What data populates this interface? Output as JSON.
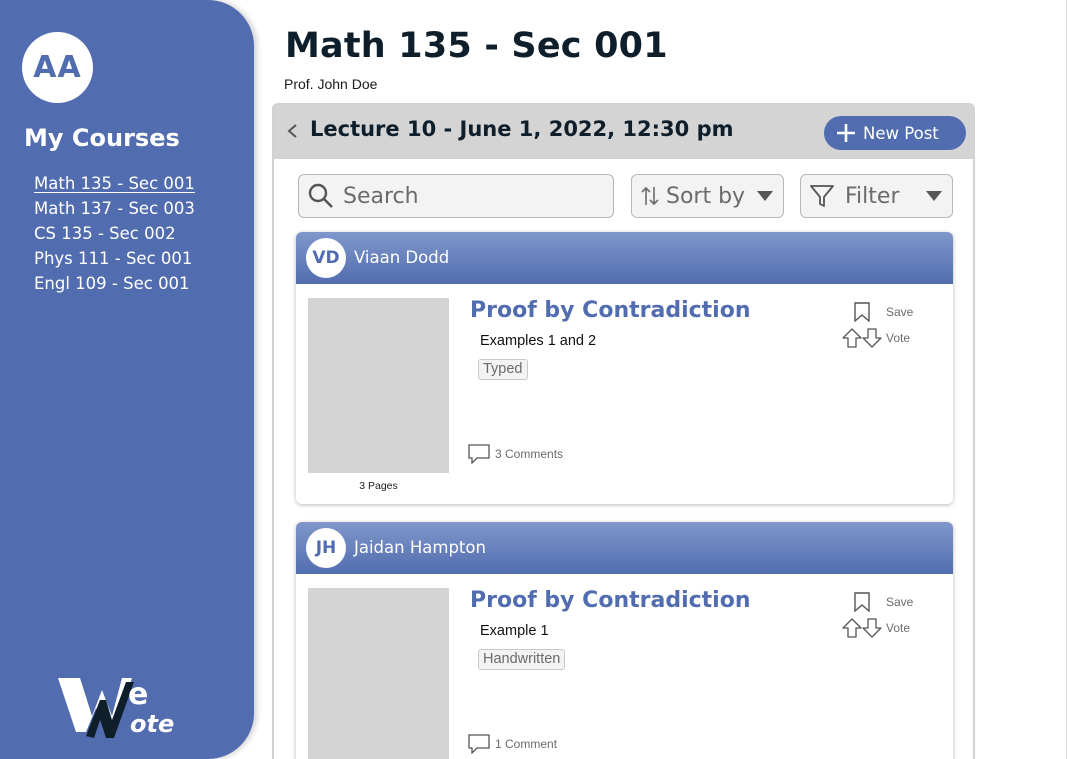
{
  "user": {
    "initials": "AA"
  },
  "sidebar": {
    "heading": "My Courses",
    "courses": [
      {
        "label": "Math 135 - Sec 001",
        "active": true
      },
      {
        "label": "Math 137 - Sec 003",
        "active": false
      },
      {
        "label": "CS 135 - Sec 002",
        "active": false
      },
      {
        "label": "Phys 111 - Sec 001",
        "active": false
      },
      {
        "label": "Engl 109 - Sec 001",
        "active": false
      }
    ],
    "logo_text": "WeNote"
  },
  "header": {
    "title": "Math 135 - Sec 001",
    "professor": "Prof. John Doe"
  },
  "lecture": {
    "title": "Lecture 10 - June 1, 2022, 12:30 pm",
    "new_post_label": "New Post"
  },
  "toolbar": {
    "search_placeholder": "Search",
    "sort_label": "Sort by",
    "filter_label": "Filter"
  },
  "posts": [
    {
      "initials": "VD",
      "author": "Viaan Dodd",
      "title": "Proof by Contradiction",
      "subtitle": "Examples 1 and 2",
      "tag": "Typed",
      "pages": "3 Pages",
      "comments": "3 Comments",
      "save_label": "Save",
      "vote_label": "Vote"
    },
    {
      "initials": "JH",
      "author": "Jaidan Hampton",
      "title": "Proof by Contradiction",
      "subtitle": "Example 1",
      "tag": "Handwritten",
      "pages": "",
      "comments": "1 Comment",
      "save_label": "Save",
      "vote_label": "Vote"
    }
  ],
  "colors": {
    "primary": "#526daf",
    "header_gradient_top": "#7f97cb",
    "title_text": "#0e1e2b",
    "panel_header": "#d4d4d4",
    "muted_text": "#6b6b6b"
  },
  "icons": [
    "back-chevron-icon",
    "plus-icon",
    "search-icon",
    "sort-icon",
    "filter-icon",
    "caret-down-icon",
    "bookmark-icon",
    "upvote-arrow-icon",
    "downvote-arrow-icon",
    "comment-icon"
  ]
}
